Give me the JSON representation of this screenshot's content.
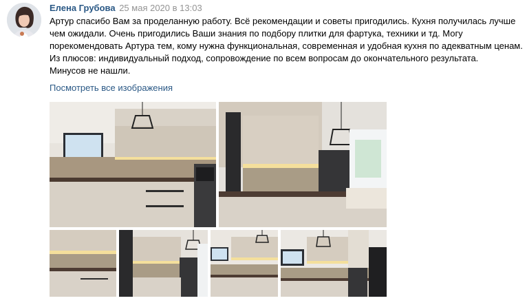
{
  "post": {
    "author": "Елена Грубова",
    "date": "25 мая 2020 в 13:03",
    "paragraphs": [
      "Артур спасибо Вам за проделанную работу. Всё рекомендации и советы пригодились. Кухня получилась лучше чем ожидали. Очень пригодились Ваши знания по подбору плитки для фартука, техники и тд. Могу порекомендовать Артура тем, кому нужна функциональная, современная и удобная кухня по адекватным ценам. Из плюсов: индивидуальный подход, сопровождение по всем вопросам до окончательного результата.",
      "Минусов не нашли."
    ],
    "more_link": "Посмотреть все изображения"
  },
  "colors": {
    "link": "#2a5885",
    "date": "#939393"
  },
  "photos": [
    {
      "subject": "kitchen-corner-with-tv"
    },
    {
      "subject": "kitchen-with-window"
    },
    {
      "subject": "kitchen-counter-closeup"
    },
    {
      "subject": "kitchen-tall-units"
    },
    {
      "subject": "kitchen-tv-wall"
    },
    {
      "subject": "kitchen-overview"
    }
  ]
}
